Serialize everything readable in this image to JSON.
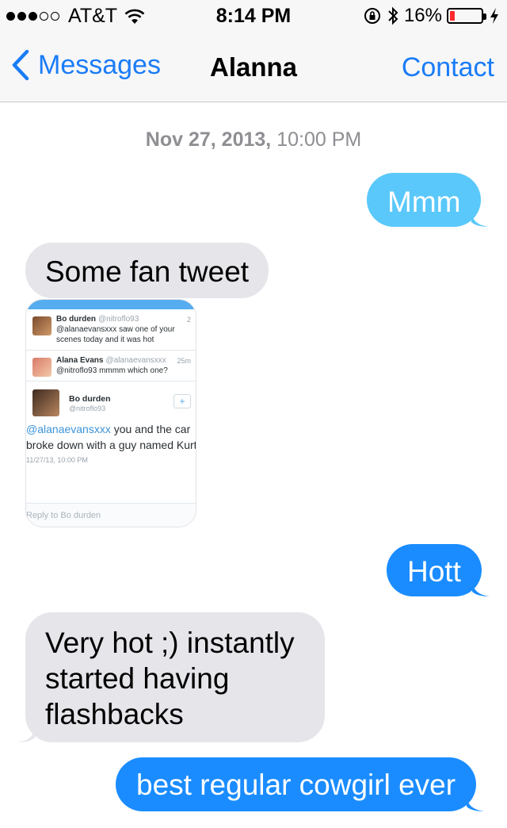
{
  "status_bar": {
    "carrier": "AT&T",
    "time": "8:14 PM",
    "battery": "16%",
    "battery_level": 0.16,
    "signal_bars_filled": 3,
    "signal_bars_total": 5,
    "icons": [
      "wifi-icon",
      "rotation-lock-icon",
      "bluetooth-icon",
      "battery-icon",
      "charging-icon"
    ]
  },
  "nav": {
    "back_label": "Messages",
    "title": "Alanna",
    "action_label": "Contact"
  },
  "timestamp": {
    "date": "Nov 27, 2013,",
    "time": "10:00 PM"
  },
  "messages": [
    {
      "direction": "outgoing",
      "text": "Mmm"
    },
    {
      "direction": "incoming",
      "text": "Some fan tweet"
    },
    {
      "direction": "incoming",
      "type": "image",
      "description": "tweet screenshot"
    },
    {
      "direction": "outgoing",
      "text": "Hott"
    },
    {
      "direction": "incoming",
      "text": "Very hot ;) instantly started having flashbacks"
    },
    {
      "direction": "outgoing",
      "text": "best regular cowgirl ever"
    }
  ],
  "tweet_image": {
    "rows": [
      {
        "name": "Bo durden",
        "handle": "@nitroflo93",
        "time": "2",
        "text": "@alanaevansxxx saw one of your scenes today and it was hot"
      },
      {
        "name": "Alana Evans",
        "handle": "@alanaevansxxx",
        "time": "25m",
        "text": "@nitroflo93 mmmm which one?"
      }
    ],
    "detail": {
      "name": "Bo durden",
      "handle": "@nitroflo93",
      "mention": "@alanaevansxxx",
      "text": " you and the car broke down with a guy named Kurt",
      "date": "11/27/13, 10:00 PM",
      "follow_label": "+"
    },
    "reply_label": "Reply to Bo durden"
  },
  "colors": {
    "ios_blue": "#1a7cf7",
    "outgoing_bubble": "#1a8cff",
    "outgoing_bubble_light": "#5ac8fa",
    "incoming_bubble": "#e5e5ea",
    "battery_low": "#ff2b2b"
  }
}
